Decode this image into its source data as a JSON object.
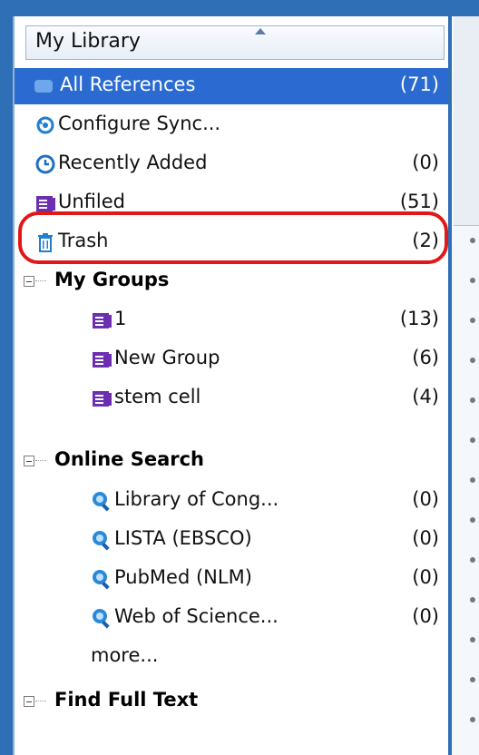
{
  "panel": {
    "title": "My Library"
  },
  "library": [
    {
      "label": "All References",
      "count": "(71)",
      "icon": "all-references-icon",
      "selected": true
    },
    {
      "label": "Configure Sync...",
      "count": "",
      "icon": "sync-icon",
      "selected": false
    },
    {
      "label": "Recently Added",
      "count": "(0)",
      "icon": "clock-icon",
      "selected": false
    },
    {
      "label": "Unfiled",
      "count": "(51)",
      "icon": "unfiled-icon",
      "selected": false
    },
    {
      "label": "Trash",
      "count": "(2)",
      "icon": "trash-icon",
      "selected": false
    }
  ],
  "my_groups": {
    "header": "My Groups",
    "items": [
      {
        "label": "1",
        "count": "(13)",
        "icon": "group-icon"
      },
      {
        "label": "New Group",
        "count": "(6)",
        "icon": "group-icon"
      },
      {
        "label": "stem cell",
        "count": "(4)",
        "icon": "group-icon"
      }
    ]
  },
  "online_search": {
    "header": "Online Search",
    "items": [
      {
        "label": "Library of Cong...",
        "count": "(0)",
        "icon": "search-globe-icon"
      },
      {
        "label": "LISTA (EBSCO)",
        "count": "(0)",
        "icon": "search-globe-icon"
      },
      {
        "label": "PubMed (NLM)",
        "count": "(0)",
        "icon": "search-globe-icon"
      },
      {
        "label": "Web of Science...",
        "count": "(0)",
        "icon": "search-globe-icon"
      }
    ],
    "more": "more..."
  },
  "find_full_text": {
    "header": "Find Full Text"
  },
  "colors": {
    "selection": "#2b6bd1",
    "highlight_outline": "#e01818",
    "group_icon": "#6b2fb0",
    "search_icon": "#2a8ad8"
  }
}
